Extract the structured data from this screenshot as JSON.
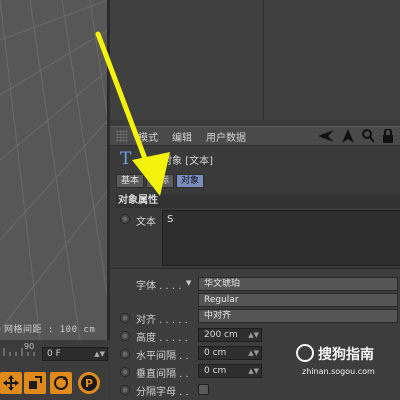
{
  "viewport": {
    "grid_spacing_label": "网格间距 : 100 cm"
  },
  "timeline": {
    "ruler_number": "90",
    "frame_value": "0 F"
  },
  "attributes": {
    "menu": {
      "mode_label": "模式",
      "edit_label": "编辑",
      "user_data_label": "用户数据"
    },
    "object_title": "对象 [文本]",
    "tabs": [
      "基本",
      "坐标",
      "对象"
    ],
    "active_tab": "对象",
    "section_title": "对象属性",
    "text_label": "文本",
    "text_value": "S",
    "font_label": "字体 . . . .",
    "font_name": "华文琥珀",
    "font_style": "Regular",
    "align_label": "对齐 . . . . .",
    "align_value": "中对齐",
    "height_label": "高度 . . . . .",
    "height_value": "200 cm",
    "h_spacing_label": "水平间隔 . .",
    "h_spacing_value": "0 cm",
    "v_spacing_label": "垂直间隔 . .",
    "v_spacing_value": "0 cm",
    "separate_label": "分隔字母 . ."
  },
  "watermark": {
    "brand": "搜狗指南",
    "url": "zhinan.sogou.com"
  },
  "colors": {
    "arrow": "#f2f20a",
    "active_tab": "#7c8cbf",
    "t_icon": "#6fa0e0"
  }
}
